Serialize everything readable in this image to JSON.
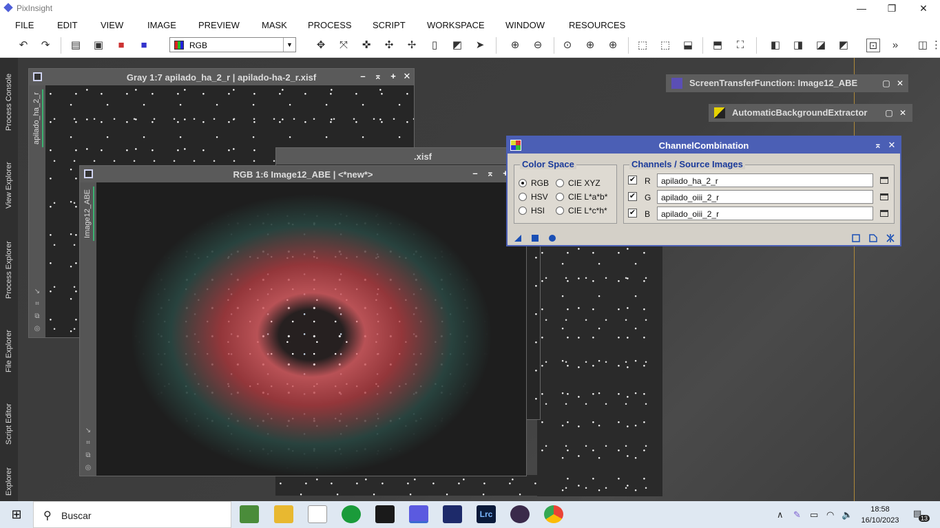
{
  "app": {
    "title": "PixInsight"
  },
  "menus": [
    "FILE",
    "EDIT",
    "VIEW",
    "IMAGE",
    "PREVIEW",
    "MASK",
    "PROCESS",
    "SCRIPT",
    "WORKSPACE",
    "WINDOW",
    "RESOURCES"
  ],
  "toolbar": {
    "color_mode": "RGB",
    "more": "»"
  },
  "side_tabs": [
    "Process Console",
    "View Explorer",
    "Process Explorer",
    "File Explorer",
    "Script Editor",
    "Explorer"
  ],
  "windows": {
    "gray": {
      "title": "Gray 1:7 apilado_ha_2_r | apilado-ha-2_r.xisf",
      "tab": "apilado_ha_2_r"
    },
    "back_partial": {
      "title": ".xisf"
    },
    "rgb": {
      "title": "RGB 1:6 Image12_ABE | <*new*>",
      "tab": "Image12_ABE"
    }
  },
  "docked": {
    "stf": {
      "title": "ScreenTransferFunction: Image12_ABE"
    },
    "abe": {
      "title": "AutomaticBackgroundExtractor"
    }
  },
  "channel_combination": {
    "title": "ChannelCombination",
    "color_space_label": "Color Space",
    "color_spaces": [
      "RGB",
      "CIE XYZ",
      "HSV",
      "CIE L*a*b*",
      "HSI",
      "CIE L*c*h*"
    ],
    "selected": "RGB",
    "channels_label": "Channels / Source Images",
    "channels": [
      {
        "label": "R",
        "checked": true,
        "image": "apilado_ha_2_r"
      },
      {
        "label": "G",
        "checked": true,
        "image": "apilado_oiii_2_r"
      },
      {
        "label": "B",
        "checked": true,
        "image": "apilado_oiii_2_r"
      }
    ]
  },
  "taskbar": {
    "search_placeholder": "Buscar",
    "time": "18:58",
    "date": "16/10/2023",
    "notifications": "13"
  }
}
